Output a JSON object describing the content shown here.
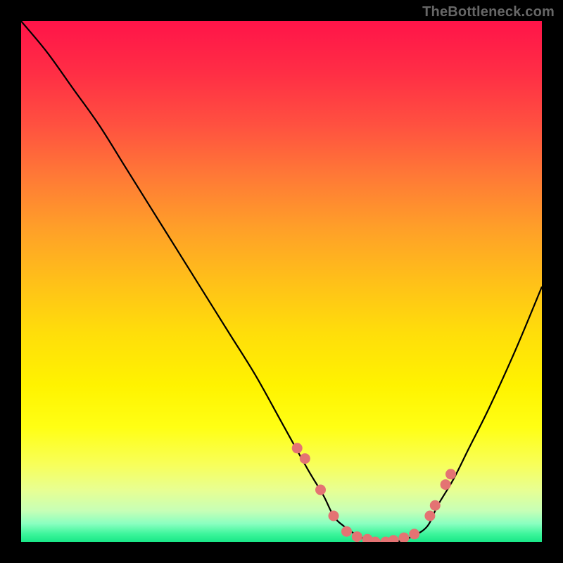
{
  "watermark": {
    "text": "TheBottleneck.com"
  },
  "colors": {
    "black": "#000000",
    "curve": "#000000",
    "marker_fill": "#e47373",
    "marker_stroke": "#b94d4d"
  },
  "gradient_stops": [
    {
      "offset": 0.0,
      "color": "#ff1449"
    },
    {
      "offset": 0.1,
      "color": "#ff2e45"
    },
    {
      "offset": 0.2,
      "color": "#ff5140"
    },
    {
      "offset": 0.3,
      "color": "#ff7a36"
    },
    {
      "offset": 0.4,
      "color": "#ffa028"
    },
    {
      "offset": 0.5,
      "color": "#ffc019"
    },
    {
      "offset": 0.6,
      "color": "#ffde0a"
    },
    {
      "offset": 0.7,
      "color": "#fff300"
    },
    {
      "offset": 0.78,
      "color": "#ffff14"
    },
    {
      "offset": 0.85,
      "color": "#f8ff58"
    },
    {
      "offset": 0.9,
      "color": "#e8ff92"
    },
    {
      "offset": 0.94,
      "color": "#c7ffb6"
    },
    {
      "offset": 0.965,
      "color": "#8affc0"
    },
    {
      "offset": 0.985,
      "color": "#3cf59b"
    },
    {
      "offset": 1.0,
      "color": "#19e787"
    }
  ],
  "chart_data": {
    "type": "line",
    "title": "",
    "xlabel": "",
    "ylabel": "",
    "xlim": [
      0,
      100
    ],
    "ylim": [
      0,
      100
    ],
    "series": [
      {
        "name": "bottleneck-curve",
        "x": [
          0,
          5,
          10,
          15,
          20,
          25,
          30,
          35,
          40,
          45,
          50,
          55,
          58,
          60,
          62,
          65,
          68,
          70,
          72,
          75,
          78,
          80,
          83,
          86,
          90,
          95,
          100
        ],
        "values": [
          100,
          94,
          87,
          80,
          72,
          64,
          56,
          48,
          40,
          32,
          23,
          14,
          9,
          5,
          3,
          1,
          0,
          0,
          0,
          1,
          3,
          7,
          12,
          18,
          26,
          37,
          49
        ]
      }
    ],
    "markers": {
      "name": "highlight-dots",
      "x": [
        53,
        54.5,
        57.5,
        60,
        62.5,
        64.5,
        66.5,
        68,
        70,
        71.5,
        73.5,
        75.5,
        78.5,
        79.5,
        81.5,
        82.5
      ],
      "values": [
        18,
        16,
        10,
        5,
        2,
        1,
        0.5,
        0,
        0,
        0.3,
        0.8,
        1.5,
        5,
        7,
        11,
        13
      ]
    }
  }
}
